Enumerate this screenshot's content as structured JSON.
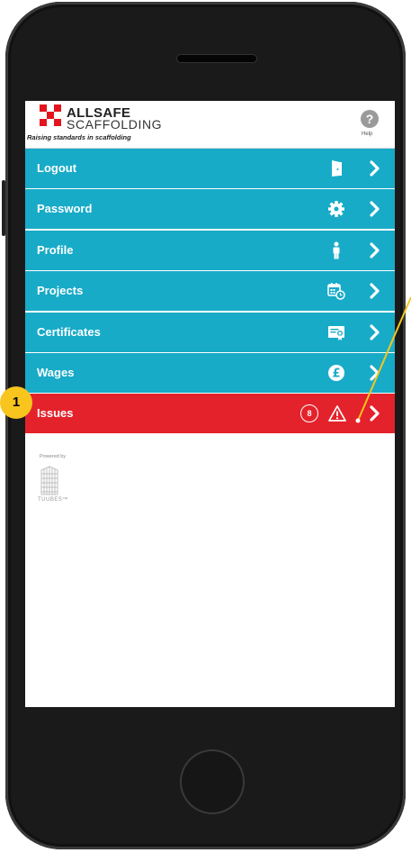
{
  "header": {
    "brand_line1": "ALLSAFE",
    "brand_line2": "SCAFFOLDING",
    "tagline": "Raising standards in scaffolding",
    "help_label": "Help",
    "help_glyph": "?"
  },
  "menu": {
    "items": [
      {
        "label": "Logout",
        "icon": "door-icon"
      },
      {
        "label": "Password",
        "icon": "gear-icon"
      },
      {
        "label": "Profile",
        "icon": "person-icon"
      },
      {
        "label": "Projects",
        "icon": "calendar-clock-icon"
      },
      {
        "label": "Certificates",
        "icon": "certificate-icon"
      },
      {
        "label": "Wages",
        "icon": "pound-coin-icon"
      },
      {
        "label": "Issues",
        "icon": "warning-icon",
        "badge": "8"
      }
    ]
  },
  "footer": {
    "powered_by": "Powered by",
    "product": "TUUBES™"
  },
  "annotation": {
    "step_number": "1"
  },
  "colors": {
    "menu_bg": "#18abc8",
    "issues_bg": "#e4222b",
    "brand_red": "#e3141d",
    "annotation_yellow": "#f7c51d"
  }
}
